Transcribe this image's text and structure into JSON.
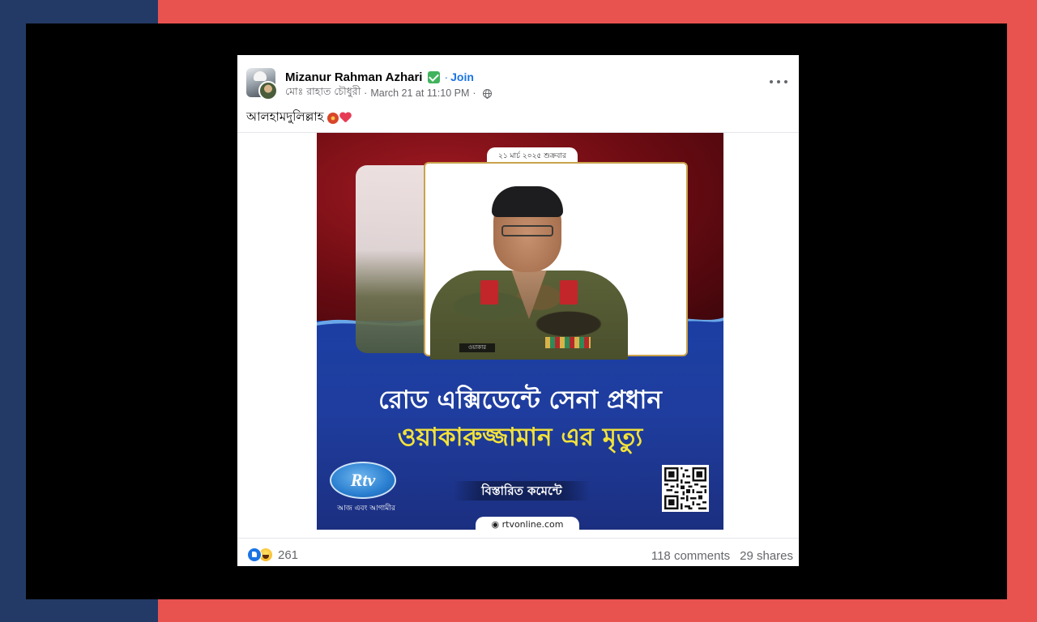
{
  "post": {
    "author": "Mizanur Rahman Azhari",
    "join_separator": "·",
    "join_label": "Join",
    "poster": "মোঃ রাহাত চৌধুরী",
    "timestamp": "March 21 at 11:10 PM",
    "meta_separator": "·",
    "text": "আলহামদুলিল্লাহ"
  },
  "image": {
    "date_label": "২১ মার্চ ২০২৫ শুক্রবার",
    "headline_line1": "রোড এক্সিডেন্টে সেনা প্রধান",
    "headline_line2": "ওয়াকারুজ্জামান এর মৃত্যু",
    "logo_text": "Rtv",
    "logo_tagline": "আজ এবং আগামীর",
    "details_label": "বিস্তারিত কমেন্টে",
    "site_label": "rtvonline.com",
    "nameplate": "ওয়াকার"
  },
  "footer": {
    "reaction_count": "261",
    "comments_label": "118 comments",
    "shares_label": "29 shares"
  },
  "colors": {
    "accent_blue": "#1b74e4",
    "verified_green": "#41b35d",
    "headline_yellow": "#f3e23a",
    "bg_left": "#243a66",
    "bg_right": "#e8534f"
  },
  "icons": [
    "verified-icon",
    "globe-icon",
    "more-options-icon",
    "flower-icon",
    "heart-icon",
    "like-icon",
    "haha-icon",
    "qr-code"
  ]
}
